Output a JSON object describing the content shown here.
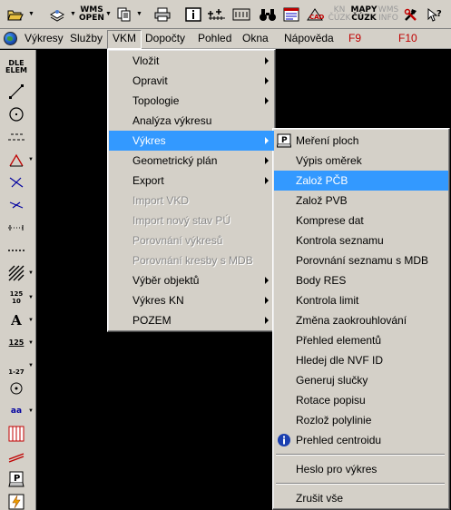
{
  "toolbar": {
    "items": [
      {
        "id": "open",
        "icon": "folder-open-icon"
      },
      {
        "id": "layers",
        "icon": "layers-icon"
      },
      {
        "id": "wms_open",
        "label": "WMS\nOPEN"
      },
      {
        "id": "copy",
        "icon": "copy-pages-icon"
      },
      {
        "id": "print",
        "icon": "printer-icon"
      },
      {
        "id": "info",
        "icon": "info-box-icon"
      },
      {
        "id": "measure_plus",
        "icon": "measure-plus-icon"
      },
      {
        "id": "measure_box",
        "icon": "measure-box-icon"
      },
      {
        "id": "find",
        "icon": "binoculars-icon"
      },
      {
        "id": "flag",
        "icon": "flag-window-icon"
      },
      {
        "id": "cad",
        "icon": "cad-icon"
      },
      {
        "id": "kn_cuzk",
        "label": "KN\nČÚZK",
        "disabled": true
      },
      {
        "id": "mapy_cuzk",
        "label": "MAPY\nČÚZK"
      },
      {
        "id": "wms_info",
        "label": "WMS\nINFO",
        "disabled": true
      },
      {
        "id": "tools",
        "icon": "hammer-wrench-icon"
      },
      {
        "id": "help",
        "icon": "help-arrow-icon"
      }
    ]
  },
  "menubar": {
    "items": [
      {
        "label": "Výkresy"
      },
      {
        "label": "Služby"
      },
      {
        "label": "VKM",
        "active": true
      },
      {
        "label": "Dopočty"
      },
      {
        "label": "Pohled"
      },
      {
        "label": "Okna"
      },
      {
        "label": "Nápověda"
      },
      {
        "label": "F9",
        "red": true
      },
      {
        "label": "F10",
        "red": true
      }
    ]
  },
  "lefttoolbar": {
    "items": [
      {
        "label": "DLE\nELEM"
      },
      {
        "icon": "line-icon"
      },
      {
        "icon": "circle-icon"
      },
      {
        "icon": "dashed-line-icon"
      },
      {
        "icon": "angle-icon"
      },
      {
        "icon": "cross-line-icon"
      },
      {
        "icon": "cross-line-2-icon"
      },
      {
        "icon": "dotted-line-icon"
      },
      {
        "icon": "short-dash-icon"
      },
      {
        "icon": "hatch-icon"
      },
      {
        "label": "125\n10"
      },
      {
        "label": "A"
      },
      {
        "label": "125"
      },
      {
        "label": "1-27"
      },
      {
        "icon": "target-icon"
      },
      {
        "label": "aa"
      },
      {
        "icon": "red-columns-icon"
      },
      {
        "icon": "red-lines-icon"
      },
      {
        "label": "P"
      },
      {
        "icon": "lightning-icon"
      }
    ]
  },
  "vkm_menu": {
    "items": [
      {
        "label": "Vložit",
        "submenu": true
      },
      {
        "label": "Opravit",
        "submenu": true
      },
      {
        "label": "Topologie",
        "submenu": true
      },
      {
        "label": "Analýza výkresu"
      },
      {
        "label": "Výkres",
        "submenu": true,
        "highlighted": true
      },
      {
        "label": "Geometrický plán",
        "submenu": true
      },
      {
        "label": "Export",
        "submenu": true
      },
      {
        "label": "Import VKD",
        "disabled": true
      },
      {
        "label": "Import nový stav PÚ",
        "disabled": true
      },
      {
        "label": "Porovnání výkresů",
        "disabled": true
      },
      {
        "label": "Porovnání  kresby s MDB",
        "disabled": true
      },
      {
        "label": "Výběr objektů",
        "submenu": true
      },
      {
        "label": "Výkres KN",
        "submenu": true
      },
      {
        "label": "POZEM",
        "submenu": true
      }
    ]
  },
  "vykres_submenu": {
    "items": [
      {
        "label": "Meření ploch",
        "icon": "p-icon"
      },
      {
        "label": "Výpis oměrek"
      },
      {
        "label": "Založ PČB",
        "highlighted": true
      },
      {
        "label": "Založ PVB"
      },
      {
        "label": "Komprese dat"
      },
      {
        "label": "Kontrola seznamu"
      },
      {
        "label": "Porovnání seznamu s MDB"
      },
      {
        "label": "Body RES"
      },
      {
        "label": "Kontrola limit"
      },
      {
        "label": "Změna zaokrouhlování"
      },
      {
        "label": "Přehled elementů"
      },
      {
        "label": "Hledej dle NVF ID"
      },
      {
        "label": "Generuj slučky"
      },
      {
        "label": "Rotace popisu"
      },
      {
        "label": "Rozlož polylinie"
      },
      {
        "label": "Prehled centroidu",
        "icon": "info-circle-icon"
      },
      {
        "label": "Heslo pro výkres",
        "separator_before": true
      },
      {
        "label": "Zrušit vše",
        "separator_before": true
      }
    ]
  },
  "colors": {
    "face": "#d4d0c8",
    "highlight": "#3399ff",
    "canvas": "#000000",
    "menubar_red": "#c00000"
  }
}
